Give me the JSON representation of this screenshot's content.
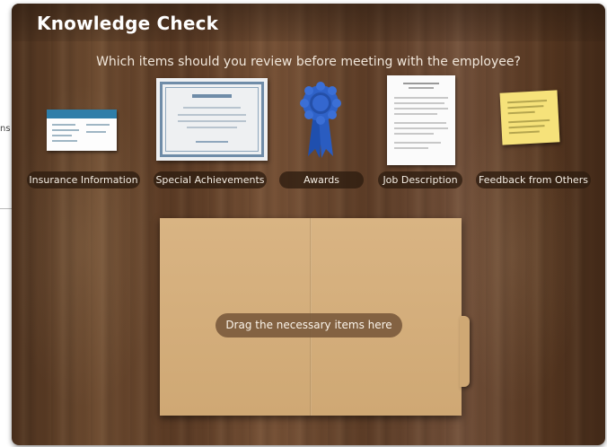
{
  "backdrop": {
    "partial_text": "ns"
  },
  "panel": {
    "title": "Knowledge Check",
    "question": "Which items should you review before meeting with the employee?"
  },
  "items": [
    {
      "label": "Insurance Information",
      "icon": "insurance-card-icon"
    },
    {
      "label": "Special Achievements",
      "icon": "certificate-icon"
    },
    {
      "label": "Awards",
      "icon": "award-ribbon-icon"
    },
    {
      "label": "Job Description",
      "icon": "document-icon"
    },
    {
      "label": "Feedback from Others",
      "icon": "sticky-note-icon"
    }
  ],
  "dropzone": {
    "label": "Drag the necessary items here",
    "icon": "folder-icon"
  },
  "colors": {
    "ribbon": "#2f62c8",
    "folder": "#d4ad7a",
    "sticky": "#f6e27a",
    "card_band": "#2e7ea9"
  }
}
